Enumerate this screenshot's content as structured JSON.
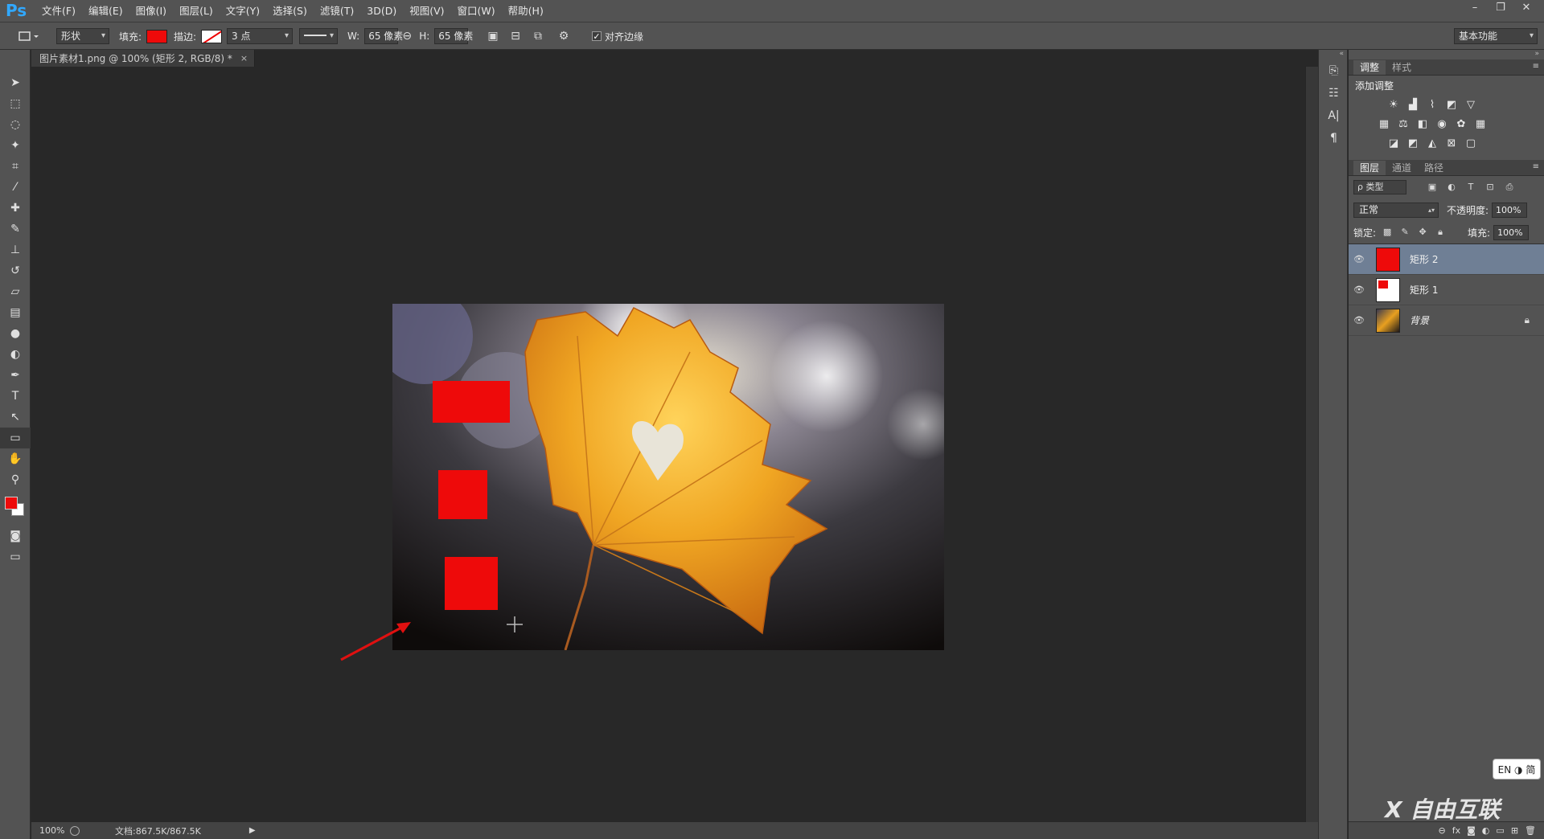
{
  "app": {
    "logo": "Ps"
  },
  "menu": [
    "文件(F)",
    "编辑(E)",
    "图像(I)",
    "图层(L)",
    "文字(Y)",
    "选择(S)",
    "滤镜(T)",
    "3D(D)",
    "视图(V)",
    "窗口(W)",
    "帮助(H)"
  ],
  "window_controls": {
    "minimize": "–",
    "restore": "❐",
    "close": "✕"
  },
  "options": {
    "mode": "形状",
    "fill_label": "填充:",
    "fill_color": "#ee0a0a",
    "stroke_label": "描边:",
    "stroke_size": "3 点",
    "width_label": "W:",
    "width_value": "65 像素",
    "height_label": "H:",
    "height_value": "65 像素",
    "align_edges_label": "对齐边缘",
    "align_edges_checked": true,
    "workspace": "基本功能"
  },
  "document": {
    "tab_title": "图片素材1.png @ 100% (矩形 2, RGB/8) *",
    "tab_close": "×",
    "zoom": "100%",
    "doc_size": "文档:867.5K/867.5K"
  },
  "colors": {
    "foreground": "#ee0a0a",
    "background": "#ffffff",
    "accent_red": "#ee0a0a",
    "selection": "#6f7f95"
  },
  "adjustments": {
    "tabs": [
      "调整",
      "样式"
    ],
    "title": "添加调整"
  },
  "layers": {
    "tabs": [
      "图层",
      "通道",
      "路径"
    ],
    "filter": "ρ 类型",
    "blend_mode": "正常",
    "opacity_label": "不透明度:",
    "opacity": "100%",
    "lock_label": "锁定:",
    "fill_label": "填充:",
    "fill": "100%",
    "items": [
      {
        "name": "矩形 2",
        "selected": true
      },
      {
        "name": "矩形 1",
        "selected": false
      },
      {
        "name": "背景",
        "selected": false,
        "locked": true
      }
    ]
  },
  "ime": "EN ◑ 简",
  "watermark": "X 自由互联"
}
